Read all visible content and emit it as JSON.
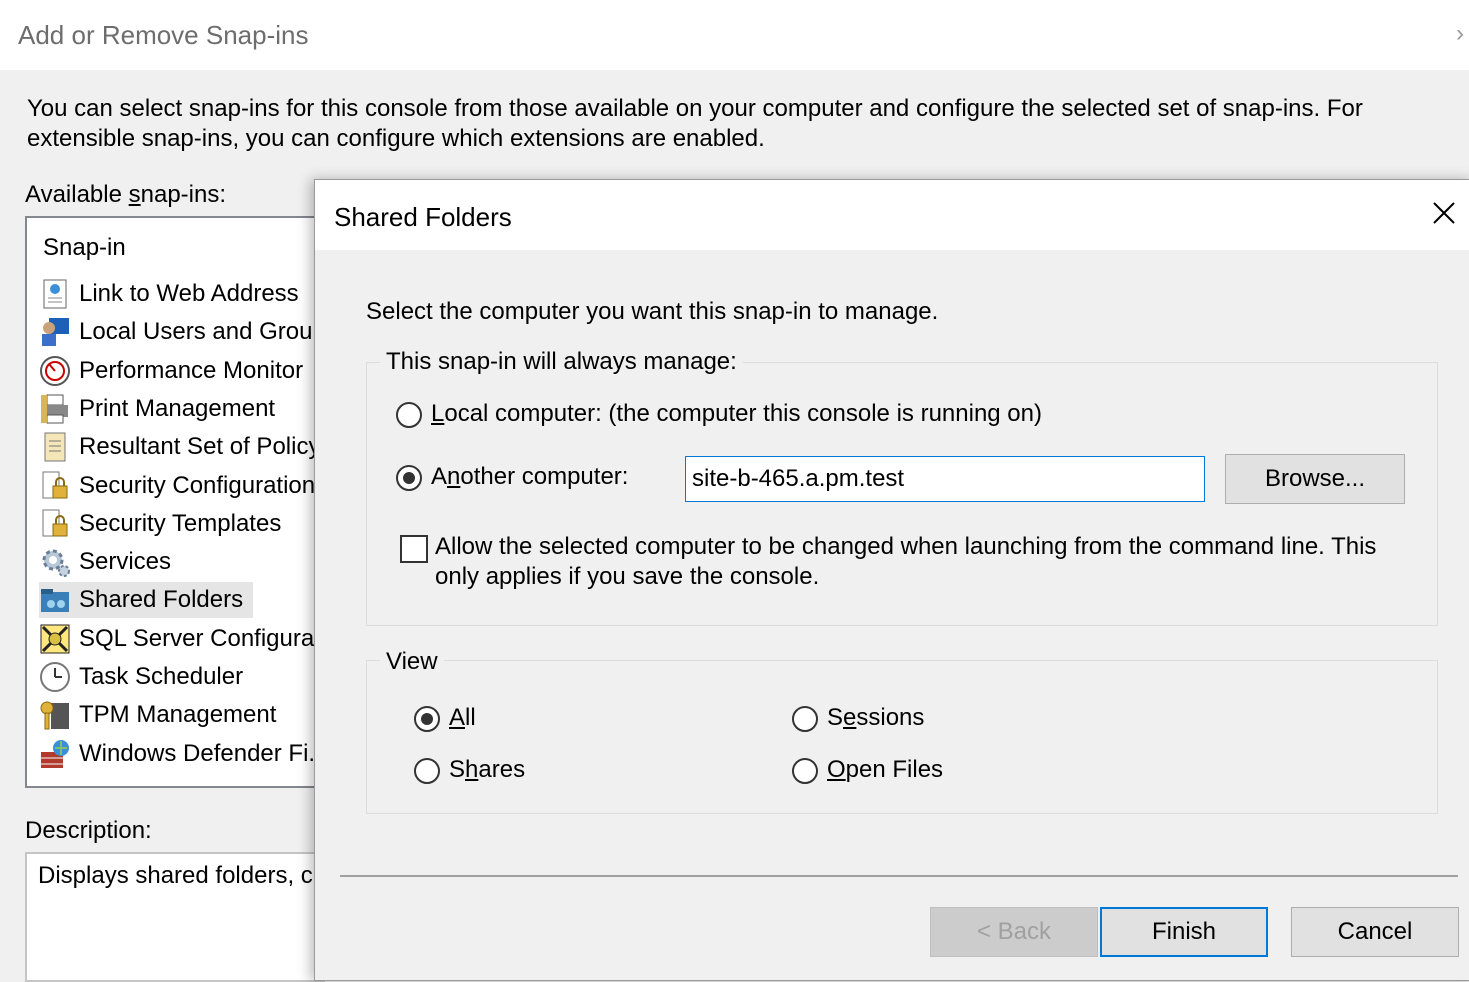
{
  "background_dialog": {
    "title": "Add or Remove Snap-ins",
    "close_glyph": "›",
    "intro": "You can select snap-ins for this console from those available on your computer and configure the selected set of snap-ins. For extensible snap-ins, you can configure which extensions are enabled.",
    "available_label": "Available snap-ins:",
    "list_header": "Snap-in",
    "snapins": [
      {
        "label": "Link to Web Address",
        "icon": "web-link-icon"
      },
      {
        "label": "Local Users and Groups",
        "icon": "users-icon"
      },
      {
        "label": "Performance Monitor",
        "icon": "performance-icon"
      },
      {
        "label": "Print Management",
        "icon": "printer-icon"
      },
      {
        "label": "Resultant Set of Policy",
        "icon": "policy-icon"
      },
      {
        "label": "Security Configuration...",
        "icon": "security-config-icon"
      },
      {
        "label": "Security Templates",
        "icon": "security-template-icon"
      },
      {
        "label": "Services",
        "icon": "gear-icon"
      },
      {
        "label": "Shared Folders",
        "icon": "shared-folder-icon"
      },
      {
        "label": "SQL Server Configurat...",
        "icon": "sql-config-icon"
      },
      {
        "label": "Task Scheduler",
        "icon": "clock-icon"
      },
      {
        "label": "TPM Management",
        "icon": "tpm-icon"
      },
      {
        "label": "Windows Defender Fi...",
        "icon": "firewall-icon"
      }
    ],
    "selected_snapin": "Shared Folders",
    "description_label": "Description:",
    "description_text": "Displays shared folders, cu"
  },
  "dialog": {
    "title": "Shared Folders",
    "prompt": "Select the computer you want this snap-in to manage.",
    "manage_group_label": "This snap-in will always manage:",
    "local_option_label": "Local computer:  (the computer this console is running on)",
    "another_option_label": "Another computer:",
    "selected_target": "Another computer",
    "computer_value": "site-b-465.a.pm.test",
    "browse_label": "Browse...",
    "allow_change_label_line1": "Allow the selected computer to be changed when launching from the command line.  This",
    "allow_change_label_line2": "only applies if you save the console.",
    "allow_change_checked": false,
    "view_group_label": "View",
    "view_options": {
      "all": "All",
      "sessions": "Sessions",
      "shares": "Shares",
      "open_files": "Open Files"
    },
    "selected_view": "All",
    "back_label": "< Back",
    "finish_label": "Finish",
    "cancel_label": "Cancel"
  }
}
